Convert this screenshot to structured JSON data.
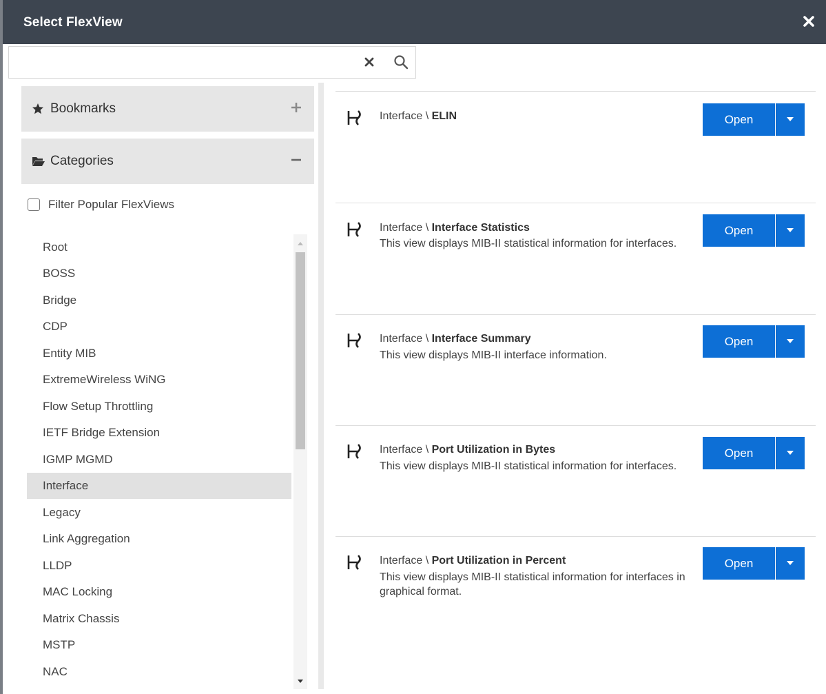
{
  "window": {
    "title": "Select FlexView"
  },
  "search": {
    "value": "",
    "placeholder": ""
  },
  "icons": {
    "close": "close-icon",
    "clear": "clear-icon",
    "search": "search-icon",
    "bookmarks": "star-icon",
    "categories": "folder-open-icon",
    "expand": "plus-icon",
    "collapse": "minus-icon",
    "view": "flexview-icon",
    "caret": "caret-down-icon"
  },
  "colors": {
    "titlebar": "#3d4550",
    "accent": "#0d6fd6",
    "selected": "#e1e1e1"
  },
  "sidebar": {
    "bookmarks_label": "Bookmarks",
    "categories_label": "Categories",
    "filter_label": "Filter Popular FlexViews",
    "filter_checked": false,
    "categories": [
      "Root",
      "BOSS",
      "Bridge",
      "CDP",
      "Entity MIB",
      "ExtremeWireless WiNG",
      "Flow Setup Throttling",
      "IETF Bridge Extension",
      "IGMP MGMD",
      "Interface",
      "Legacy",
      "Link Aggregation",
      "LLDP",
      "MAC Locking",
      "Matrix Chassis",
      "MSTP",
      "NAC"
    ],
    "selected_category": "Interface"
  },
  "views": [
    {
      "category": "Interface \\ ",
      "name": "ELIN",
      "description": "",
      "open_label": "Open"
    },
    {
      "category": "Interface \\ ",
      "name": "Interface Statistics",
      "description": "This view displays MIB-II statistical information for interfaces.",
      "open_label": "Open"
    },
    {
      "category": "Interface \\ ",
      "name": "Interface Summary",
      "description": "This view displays MIB-II interface information.",
      "open_label": "Open"
    },
    {
      "category": "Interface \\ ",
      "name": "Port Utilization in Bytes",
      "description": "This view displays MIB-II statistical information for interfaces.",
      "open_label": "Open"
    },
    {
      "category": "Interface \\ ",
      "name": "Port Utilization in Percent",
      "description": "This view displays MIB-II statistical information for interfaces in graphical format.",
      "open_label": "Open"
    }
  ]
}
